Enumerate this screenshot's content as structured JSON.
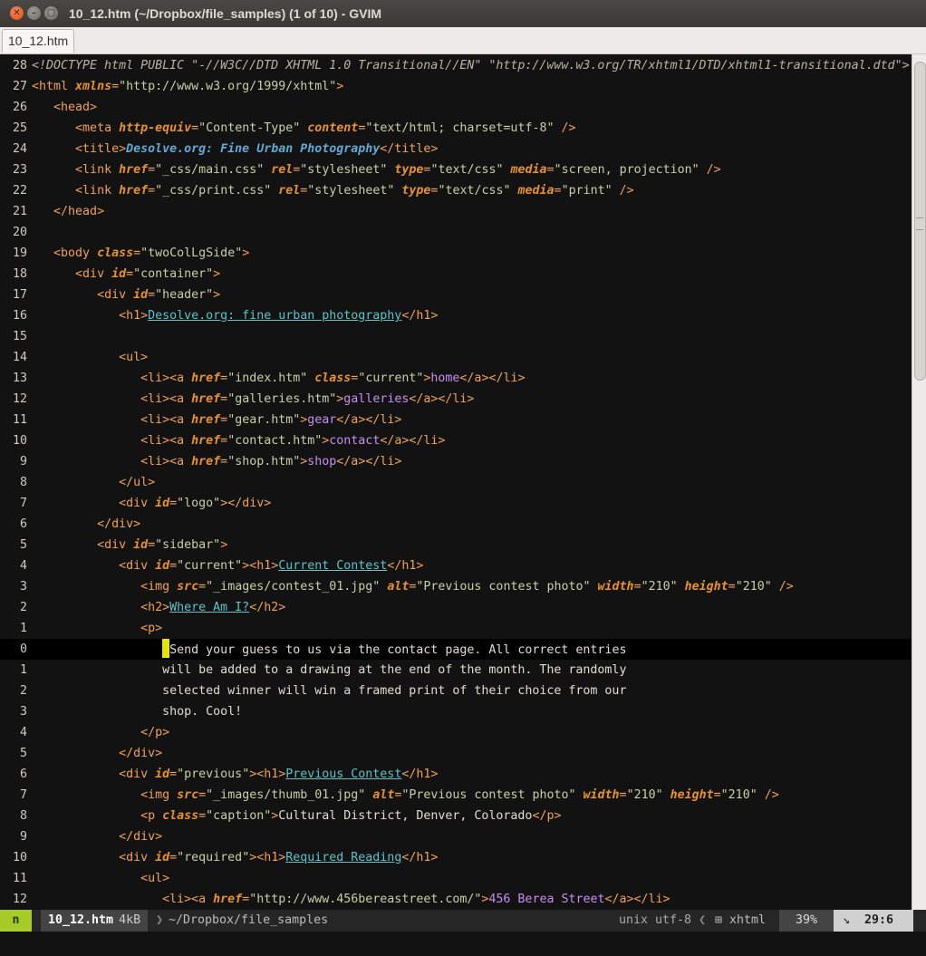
{
  "window": {
    "title": "10_12.htm (~/Dropbox/file_samples) (1 of 10) - GVIM",
    "close_glyph": "✕",
    "min_glyph": "–",
    "max_glyph": "□"
  },
  "tab": {
    "label": "10_12.htm"
  },
  "editor": {
    "lines": [
      {
        "n": "28",
        "segs": [
          [
            "dt",
            "<!DOCTYPE html PUBLIC \"-//W3C//DTD XHTML 1.0 Transitional//EN\" \"http://www.w3.org/TR/xhtml1/DTD/xhtml1-transitional.dtd\">"
          ]
        ]
      },
      {
        "n": "27",
        "segs": [
          [
            "t",
            "<html "
          ],
          [
            "a",
            "xmlns"
          ],
          [
            "t",
            "="
          ],
          [
            "s",
            "\"http://www.w3.org/1999/xhtml\""
          ],
          [
            "t",
            ">"
          ]
        ]
      },
      {
        "n": "26",
        "segs": [
          [
            "x",
            "   "
          ],
          [
            "t",
            "<head>"
          ]
        ]
      },
      {
        "n": "25",
        "segs": [
          [
            "x",
            "      "
          ],
          [
            "t",
            "<meta "
          ],
          [
            "a",
            "http-equiv"
          ],
          [
            "t",
            "="
          ],
          [
            "s",
            "\"Content-Type\""
          ],
          [
            "x",
            " "
          ],
          [
            "a",
            "content"
          ],
          [
            "t",
            "="
          ],
          [
            "s",
            "\"text/html; charset=utf-8\""
          ],
          [
            "t",
            " />"
          ]
        ]
      },
      {
        "n": "24",
        "segs": [
          [
            "x",
            "      "
          ],
          [
            "t",
            "<title>"
          ],
          [
            "ti",
            "Desolve.org: Fine Urban Photography"
          ],
          [
            "t",
            "</title>"
          ]
        ]
      },
      {
        "n": "23",
        "segs": [
          [
            "x",
            "      "
          ],
          [
            "t",
            "<link "
          ],
          [
            "a",
            "href"
          ],
          [
            "t",
            "="
          ],
          [
            "s",
            "\"_css/main.css\""
          ],
          [
            "x",
            " "
          ],
          [
            "a",
            "rel"
          ],
          [
            "t",
            "="
          ],
          [
            "s",
            "\"stylesheet\""
          ],
          [
            "x",
            " "
          ],
          [
            "a",
            "type"
          ],
          [
            "t",
            "="
          ],
          [
            "s",
            "\"text/css\""
          ],
          [
            "x",
            " "
          ],
          [
            "a",
            "media"
          ],
          [
            "t",
            "="
          ],
          [
            "s",
            "\"screen, projection\""
          ],
          [
            "t",
            " />"
          ]
        ]
      },
      {
        "n": "22",
        "segs": [
          [
            "x",
            "      "
          ],
          [
            "t",
            "<link "
          ],
          [
            "a",
            "href"
          ],
          [
            "t",
            "="
          ],
          [
            "s",
            "\"_css/print.css\""
          ],
          [
            "x",
            " "
          ],
          [
            "a",
            "rel"
          ],
          [
            "t",
            "="
          ],
          [
            "s",
            "\"stylesheet\""
          ],
          [
            "x",
            " "
          ],
          [
            "a",
            "type"
          ],
          [
            "t",
            "="
          ],
          [
            "s",
            "\"text/css\""
          ],
          [
            "x",
            " "
          ],
          [
            "a",
            "media"
          ],
          [
            "t",
            "="
          ],
          [
            "s",
            "\"print\""
          ],
          [
            "t",
            " />"
          ]
        ]
      },
      {
        "n": "21",
        "segs": [
          [
            "x",
            "   "
          ],
          [
            "t",
            "</head>"
          ]
        ]
      },
      {
        "n": "20",
        "segs": []
      },
      {
        "n": "19",
        "segs": [
          [
            "x",
            "   "
          ],
          [
            "t",
            "<body "
          ],
          [
            "a",
            "class"
          ],
          [
            "t",
            "="
          ],
          [
            "s",
            "\"twoColLgSide\""
          ],
          [
            "t",
            ">"
          ]
        ]
      },
      {
        "n": "18",
        "segs": [
          [
            "x",
            "      "
          ],
          [
            "t",
            "<div "
          ],
          [
            "a",
            "id"
          ],
          [
            "t",
            "="
          ],
          [
            "s",
            "\"container\""
          ],
          [
            "t",
            ">"
          ]
        ]
      },
      {
        "n": "17",
        "segs": [
          [
            "x",
            "         "
          ],
          [
            "t",
            "<div "
          ],
          [
            "a",
            "id"
          ],
          [
            "t",
            "="
          ],
          [
            "s",
            "\"header\""
          ],
          [
            "t",
            ">"
          ]
        ]
      },
      {
        "n": "16",
        "segs": [
          [
            "x",
            "            "
          ],
          [
            "t",
            "<h1>"
          ],
          [
            "u",
            "Desolve.org: fine urban photography"
          ],
          [
            "t",
            "</h1>"
          ]
        ]
      },
      {
        "n": "15",
        "segs": []
      },
      {
        "n": "14",
        "segs": [
          [
            "x",
            "            "
          ],
          [
            "t",
            "<ul>"
          ]
        ]
      },
      {
        "n": "13",
        "segs": [
          [
            "x",
            "               "
          ],
          [
            "t",
            "<li><a "
          ],
          [
            "a",
            "href"
          ],
          [
            "t",
            "="
          ],
          [
            "s",
            "\"index.htm\""
          ],
          [
            "x",
            " "
          ],
          [
            "a",
            "class"
          ],
          [
            "t",
            "="
          ],
          [
            "s",
            "\"current\""
          ],
          [
            "t",
            ">"
          ],
          [
            "lk",
            "home"
          ],
          [
            "t",
            "</a></li>"
          ]
        ]
      },
      {
        "n": "12",
        "segs": [
          [
            "x",
            "               "
          ],
          [
            "t",
            "<li><a "
          ],
          [
            "a",
            "href"
          ],
          [
            "t",
            "="
          ],
          [
            "s",
            "\"galleries.htm\""
          ],
          [
            "t",
            ">"
          ],
          [
            "lk",
            "galleries"
          ],
          [
            "t",
            "</a></li>"
          ]
        ]
      },
      {
        "n": "11",
        "segs": [
          [
            "x",
            "               "
          ],
          [
            "t",
            "<li><a "
          ],
          [
            "a",
            "href"
          ],
          [
            "t",
            "="
          ],
          [
            "s",
            "\"gear.htm\""
          ],
          [
            "t",
            ">"
          ],
          [
            "lk",
            "gear"
          ],
          [
            "t",
            "</a></li>"
          ]
        ]
      },
      {
        "n": "10",
        "segs": [
          [
            "x",
            "               "
          ],
          [
            "t",
            "<li><a "
          ],
          [
            "a",
            "href"
          ],
          [
            "t",
            "="
          ],
          [
            "s",
            "\"contact.htm\""
          ],
          [
            "t",
            ">"
          ],
          [
            "lk",
            "contact"
          ],
          [
            "t",
            "</a></li>"
          ]
        ]
      },
      {
        "n": "9",
        "segs": [
          [
            "x",
            "               "
          ],
          [
            "t",
            "<li><a "
          ],
          [
            "a",
            "href"
          ],
          [
            "t",
            "="
          ],
          [
            "s",
            "\"shop.htm\""
          ],
          [
            "t",
            ">"
          ],
          [
            "lk",
            "shop"
          ],
          [
            "t",
            "</a></li>"
          ]
        ]
      },
      {
        "n": "8",
        "segs": [
          [
            "x",
            "            "
          ],
          [
            "t",
            "</ul>"
          ]
        ]
      },
      {
        "n": "7",
        "segs": [
          [
            "x",
            "            "
          ],
          [
            "t",
            "<div "
          ],
          [
            "a",
            "id"
          ],
          [
            "t",
            "="
          ],
          [
            "s",
            "\"logo\""
          ],
          [
            "t",
            "></div>"
          ]
        ]
      },
      {
        "n": "6",
        "segs": [
          [
            "x",
            "         "
          ],
          [
            "t",
            "</div>"
          ]
        ]
      },
      {
        "n": "5",
        "segs": [
          [
            "x",
            "         "
          ],
          [
            "t",
            "<div "
          ],
          [
            "a",
            "id"
          ],
          [
            "t",
            "="
          ],
          [
            "s",
            "\"sidebar\""
          ],
          [
            "t",
            ">"
          ]
        ]
      },
      {
        "n": "4",
        "segs": [
          [
            "x",
            "            "
          ],
          [
            "t",
            "<div "
          ],
          [
            "a",
            "id"
          ],
          [
            "t",
            "="
          ],
          [
            "s",
            "\"current\""
          ],
          [
            "t",
            "><h1>"
          ],
          [
            "u",
            "Current Contest"
          ],
          [
            "t",
            "</h1>"
          ]
        ]
      },
      {
        "n": "3",
        "segs": [
          [
            "x",
            "               "
          ],
          [
            "t",
            "<img "
          ],
          [
            "a",
            "src"
          ],
          [
            "t",
            "="
          ],
          [
            "s",
            "\"_images/contest_01.jpg\""
          ],
          [
            "x",
            " "
          ],
          [
            "a",
            "alt"
          ],
          [
            "t",
            "="
          ],
          [
            "s",
            "\"Previous contest photo\""
          ],
          [
            "x",
            " "
          ],
          [
            "a",
            "width"
          ],
          [
            "t",
            "="
          ],
          [
            "s",
            "\"210\""
          ],
          [
            "x",
            " "
          ],
          [
            "a",
            "height"
          ],
          [
            "t",
            "="
          ],
          [
            "s",
            "\"210\""
          ],
          [
            "t",
            " />"
          ]
        ]
      },
      {
        "n": "2",
        "segs": [
          [
            "x",
            "               "
          ],
          [
            "t",
            "<h2>"
          ],
          [
            "u",
            "Where Am I?"
          ],
          [
            "t",
            "</h2>"
          ]
        ]
      },
      {
        "n": "1",
        "segs": [
          [
            "x",
            "               "
          ],
          [
            "t",
            "<p>"
          ]
        ]
      },
      {
        "n": "0",
        "current": true,
        "segs": [
          [
            "x",
            "                  "
          ],
          [
            "cur",
            ""
          ],
          [
            "x",
            "Send your guess to us via the contact page. All correct entries"
          ]
        ]
      },
      {
        "n": "1",
        "segs": [
          [
            "x",
            "                  will be added to a drawing at the end of the month. The randomly"
          ]
        ]
      },
      {
        "n": "2",
        "segs": [
          [
            "x",
            "                  selected winner will win a framed print of their choice from our"
          ]
        ]
      },
      {
        "n": "3",
        "segs": [
          [
            "x",
            "                  shop. Cool!"
          ]
        ]
      },
      {
        "n": "4",
        "segs": [
          [
            "x",
            "               "
          ],
          [
            "t",
            "</p>"
          ]
        ]
      },
      {
        "n": "5",
        "segs": [
          [
            "x",
            "            "
          ],
          [
            "t",
            "</div>"
          ]
        ]
      },
      {
        "n": "6",
        "segs": [
          [
            "x",
            "            "
          ],
          [
            "t",
            "<div "
          ],
          [
            "a",
            "id"
          ],
          [
            "t",
            "="
          ],
          [
            "s",
            "\"previous\""
          ],
          [
            "t",
            "><h1>"
          ],
          [
            "u",
            "Previous Contest"
          ],
          [
            "t",
            "</h1>"
          ]
        ]
      },
      {
        "n": "7",
        "segs": [
          [
            "x",
            "               "
          ],
          [
            "t",
            "<img "
          ],
          [
            "a",
            "src"
          ],
          [
            "t",
            "="
          ],
          [
            "s",
            "\"_images/thumb_01.jpg\""
          ],
          [
            "x",
            " "
          ],
          [
            "a",
            "alt"
          ],
          [
            "t",
            "="
          ],
          [
            "s",
            "\"Previous contest photo\""
          ],
          [
            "x",
            " "
          ],
          [
            "a",
            "width"
          ],
          [
            "t",
            "="
          ],
          [
            "s",
            "\"210\""
          ],
          [
            "x",
            " "
          ],
          [
            "a",
            "height"
          ],
          [
            "t",
            "="
          ],
          [
            "s",
            "\"210\""
          ],
          [
            "t",
            " />"
          ]
        ]
      },
      {
        "n": "8",
        "segs": [
          [
            "x",
            "               "
          ],
          [
            "t",
            "<p "
          ],
          [
            "a",
            "class"
          ],
          [
            "t",
            "="
          ],
          [
            "s",
            "\"caption\""
          ],
          [
            "t",
            ">"
          ],
          [
            "x",
            "Cultural District, Denver, Colorado"
          ],
          [
            "t",
            "</p>"
          ]
        ]
      },
      {
        "n": "9",
        "segs": [
          [
            "x",
            "            "
          ],
          [
            "t",
            "</div>"
          ]
        ]
      },
      {
        "n": "10",
        "segs": [
          [
            "x",
            "            "
          ],
          [
            "t",
            "<div "
          ],
          [
            "a",
            "id"
          ],
          [
            "t",
            "="
          ],
          [
            "s",
            "\"required\""
          ],
          [
            "t",
            "><h1>"
          ],
          [
            "u",
            "Required Reading"
          ],
          [
            "t",
            "</h1>"
          ]
        ]
      },
      {
        "n": "11",
        "segs": [
          [
            "x",
            "               "
          ],
          [
            "t",
            "<ul>"
          ]
        ]
      },
      {
        "n": "12",
        "segs": [
          [
            "x",
            "                  "
          ],
          [
            "t",
            "<li><a "
          ],
          [
            "a",
            "href"
          ],
          [
            "t",
            "="
          ],
          [
            "s",
            "\"http://www.456bereastreet.com/\""
          ],
          [
            "t",
            ">"
          ],
          [
            "lk",
            "456 Berea Street"
          ],
          [
            "t",
            "</a></li>"
          ]
        ]
      }
    ]
  },
  "statusline": {
    "mode": "n",
    "filename": "10_12.htm",
    "size": "4kB",
    "path": "~/Dropbox/file_samples",
    "encoding": "unix utf-8",
    "filetype_icon": "file-type-icon",
    "filetype": "xhtml",
    "percent": "39%",
    "line_icon": "line-number-icon",
    "position": "29:6",
    "sep_right": "❯",
    "sep_left": "❮"
  },
  "colors": {
    "mode_bg": "#a7cc2a",
    "cursor": "#e5e500",
    "editor_bg": "#121212"
  }
}
